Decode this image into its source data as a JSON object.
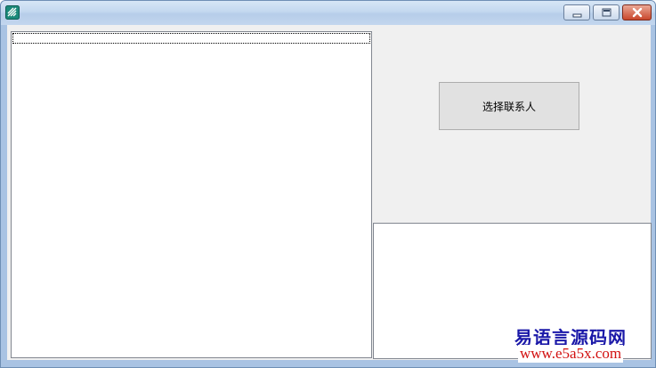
{
  "window": {
    "title": "",
    "controls": {
      "minimize": "minimize-icon",
      "maximize": "maximize-icon",
      "close": "close-icon"
    }
  },
  "main": {
    "select_contact_label": "选择联系人"
  },
  "watermark": {
    "site_name": "易语言源码网",
    "site_url": "www.e5a5x.com"
  },
  "colors": {
    "watermark_name": "#1a18a8",
    "watermark_url": "#d21010",
    "close_button": "#c9472c"
  }
}
